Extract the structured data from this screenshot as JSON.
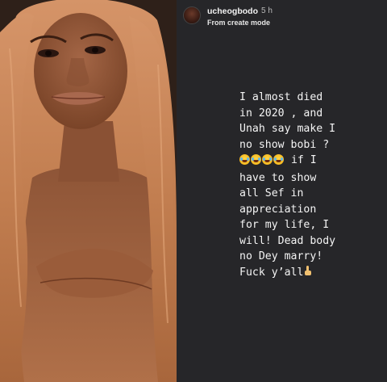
{
  "story": {
    "username": "ucheogbodo",
    "timestamp": "5 h",
    "subtitle": "From create mode",
    "lines": [
      "I almost died",
      "in 2020 , and",
      "Unah say make I",
      "no show bobi ?",
      " if I",
      "have to show",
      "all Sef in",
      "appreciation",
      "for my life, I",
      "will! Dead body",
      "no Dey marry!",
      "Fuck y’all"
    ],
    "emoji": {
      "laughing_count": 4,
      "laughing_icon": "face-with-tears-of-joy-icon",
      "finger_icon": "middle-finger-icon"
    },
    "colors": {
      "story_background": "#262629",
      "text": "#f4f4f4",
      "subtext": "#b8b8b8"
    }
  },
  "photo": {
    "icon": "portrait-photo",
    "colors": {
      "hair": "#c8875a",
      "skin": "#9a5f3e",
      "background": "#2b1e16"
    }
  }
}
